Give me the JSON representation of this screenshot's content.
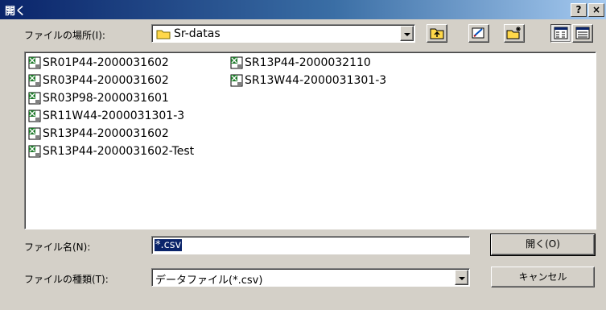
{
  "window": {
    "title": "開く",
    "help_label": "?",
    "close_label": "×"
  },
  "location": {
    "label": "ファイルの場所(I):",
    "value": "Sr-datas"
  },
  "files": [
    "SR01P44-2000031602",
    "SR03P44-2000031602",
    "SR03P98-2000031601",
    "SR11W44-2000031301-3",
    "SR13P44-2000031602",
    "SR13P44-2000031602-Test",
    "SR13P44-2000032110",
    "SR13W44-2000031301-3"
  ],
  "filename": {
    "label": "ファイル名(N):",
    "value": "*.csv"
  },
  "filetype": {
    "label": "ファイルの種類(T):",
    "value": "データファイル(*.csv)"
  },
  "buttons": {
    "open": "開く(O)",
    "cancel": "キャンセル"
  },
  "toolbar_icons": [
    "up-folder-icon",
    "desktop-icon",
    "new-folder-icon",
    "list-view-icon",
    "details-view-icon"
  ]
}
